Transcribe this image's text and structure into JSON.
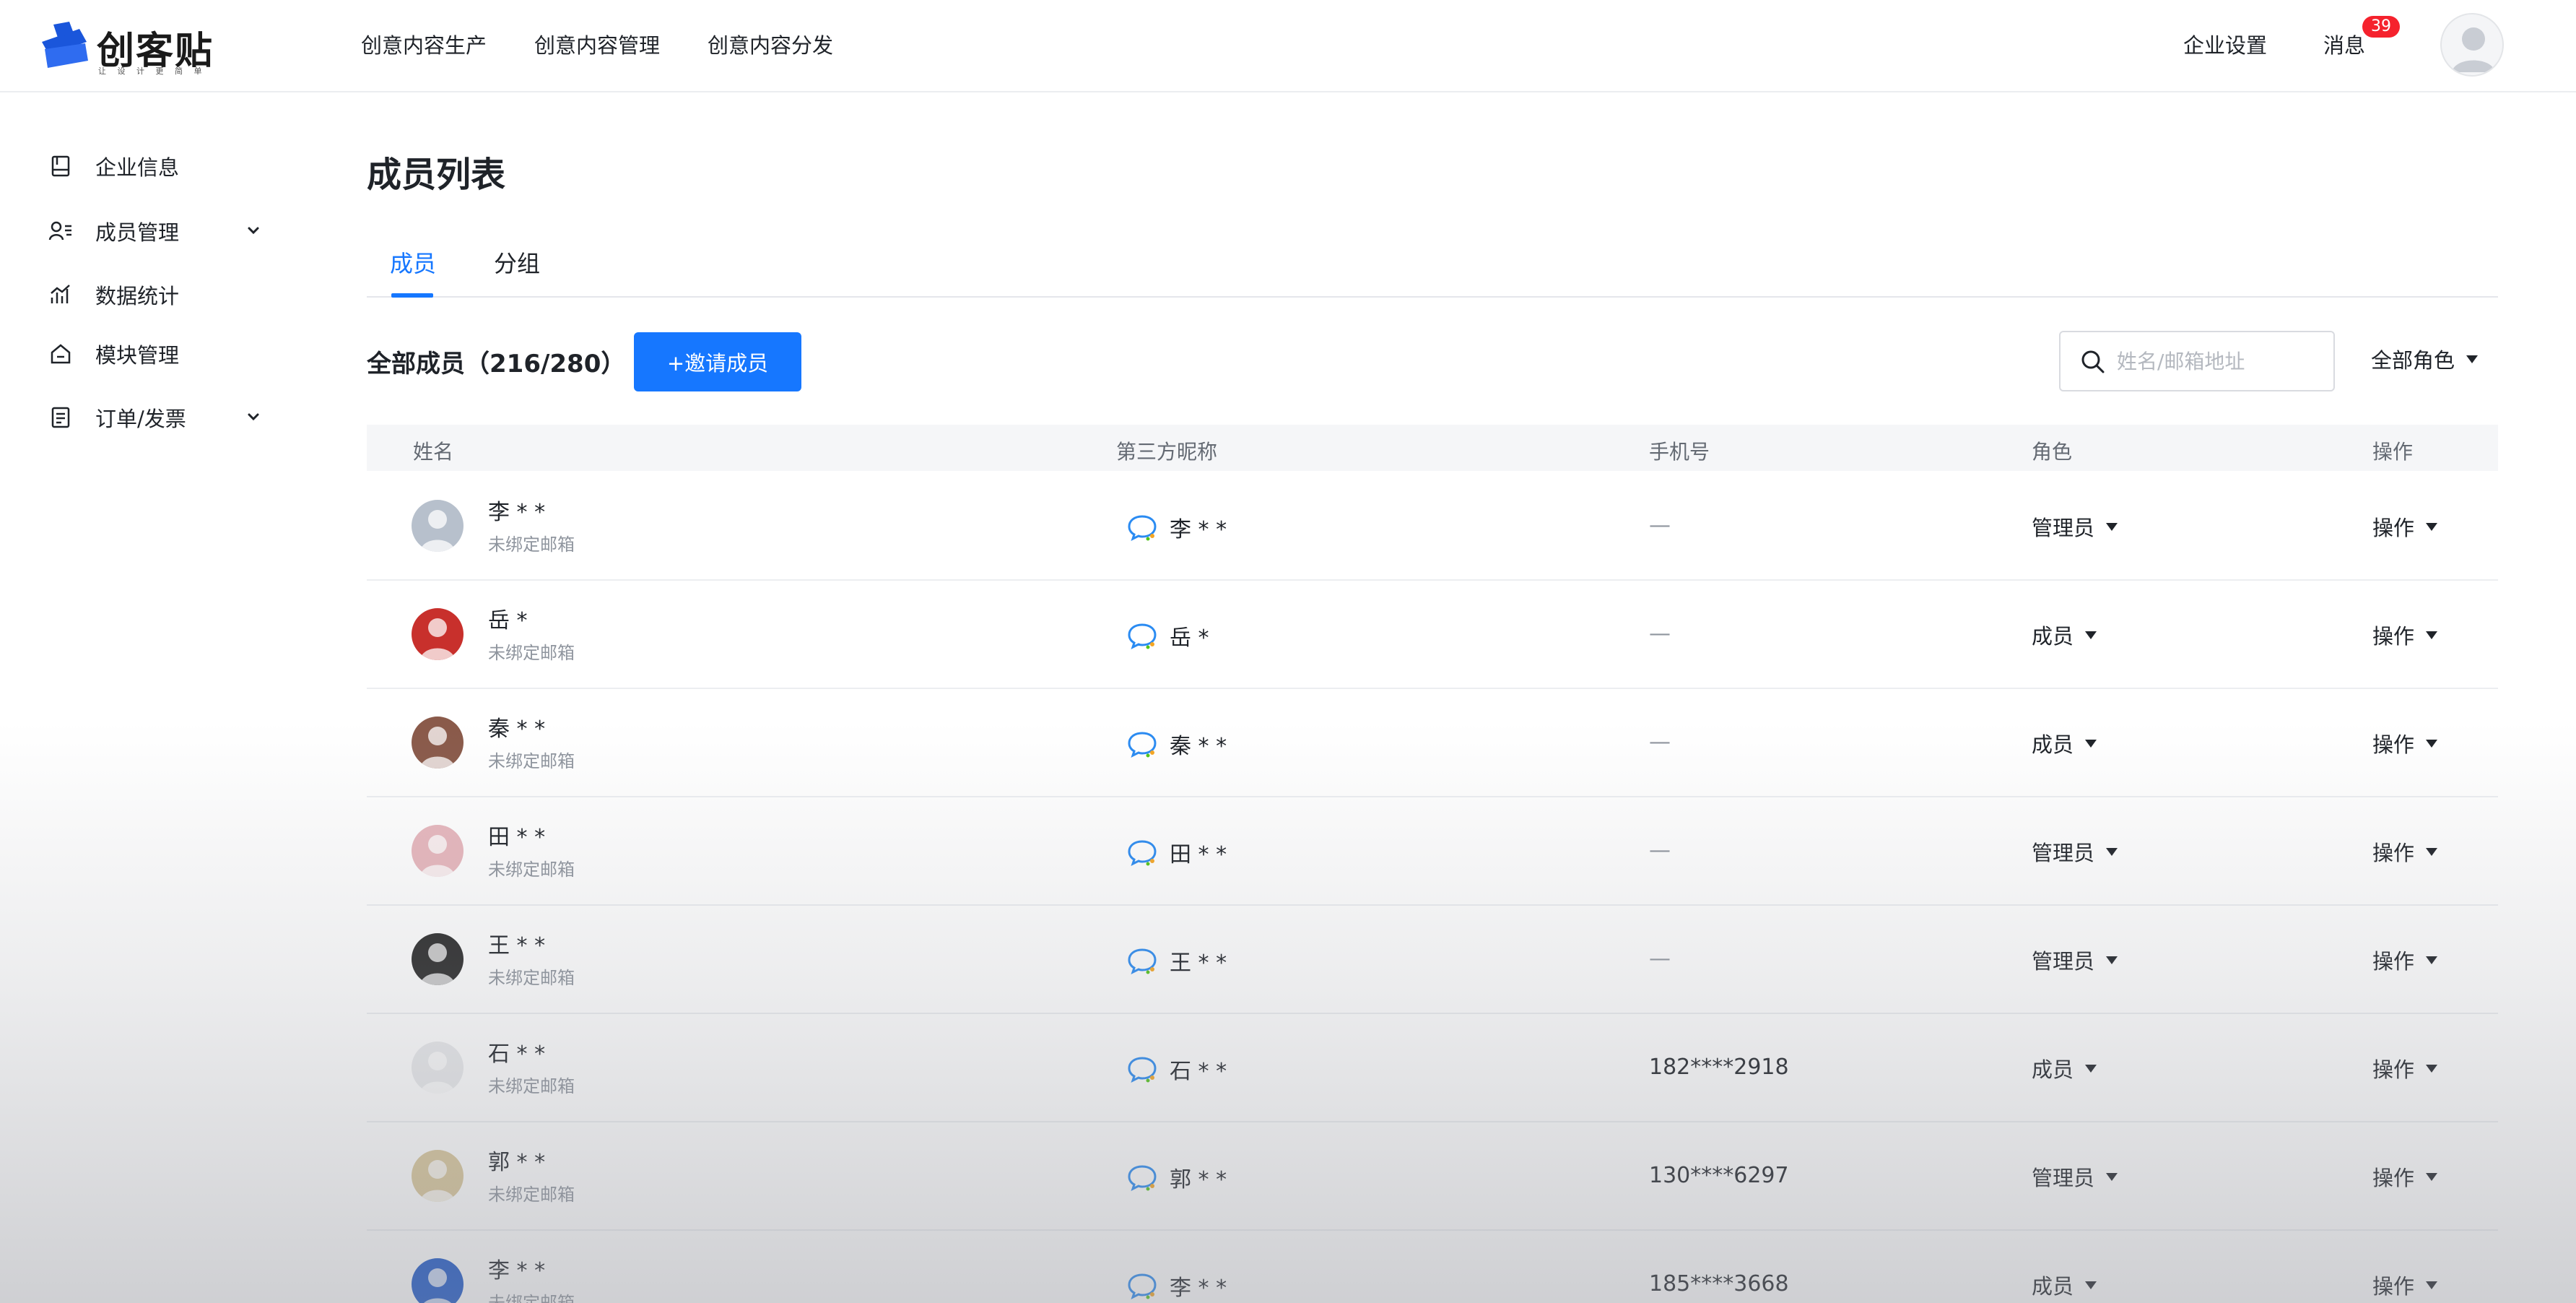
{
  "brand": {
    "name": "创客贴",
    "tagline": "让 设 计 更 简 单",
    "accent_color": "#1677ff"
  },
  "nav": {
    "items": [
      "创意内容生产",
      "创意内容管理",
      "创意内容分发"
    ]
  },
  "top_right": {
    "settings_label": "企业设置",
    "messages_label": "消息",
    "messages_badge": "39"
  },
  "sidebar": {
    "items": [
      {
        "label": "企业信息",
        "icon": "book-icon"
      },
      {
        "label": "成员管理",
        "icon": "user-list-icon"
      },
      {
        "label": "数据统计",
        "icon": "chart-icon"
      },
      {
        "label": "模块管理",
        "icon": "module-icon"
      },
      {
        "label": "订单/发票",
        "icon": "receipt-icon"
      }
    ]
  },
  "main": {
    "title": "成员列表",
    "tabs": [
      {
        "label": "成员",
        "active": true
      },
      {
        "label": "分组",
        "active": false
      }
    ],
    "member_count_label": "全部成员（216/280）",
    "invite_label": "+邀请成员",
    "search_placeholder": "姓名/邮箱地址",
    "search_value": "",
    "role_filter_label": "全部角色"
  },
  "table": {
    "headers": {
      "name": "姓名",
      "third_party": "第三方昵称",
      "phone": "手机号",
      "role": "角色",
      "action": "操作"
    },
    "rows": [
      {
        "name": "李 * *",
        "email": "未绑定邮箱",
        "third": "李 * *",
        "phone": "—",
        "role": "管理员",
        "action": "操作",
        "avatar_color": "#b7c0cc"
      },
      {
        "name": "岳 *",
        "email": "未绑定邮箱",
        "third": "岳 *",
        "phone": "—",
        "role": "成员",
        "action": "操作",
        "avatar_color": "#c8302c"
      },
      {
        "name": "秦 * *",
        "email": "未绑定邮箱",
        "third": "秦 * *",
        "phone": "—",
        "role": "成员",
        "action": "操作",
        "avatar_color": "#8a5a4a"
      },
      {
        "name": "田 * *",
        "email": "未绑定邮箱",
        "third": "田 * *",
        "phone": "—",
        "role": "管理员",
        "action": "操作",
        "avatar_color": "#e7b7bd"
      },
      {
        "name": "王 * *",
        "email": "未绑定邮箱",
        "third": "王 * *",
        "phone": "—",
        "role": "管理员",
        "action": "操作",
        "avatar_color": "#2b2b2b"
      },
      {
        "name": "石 * *",
        "email": "未绑定邮箱",
        "third": "石 * *",
        "phone": "182****2918",
        "role": "成员",
        "action": "操作",
        "avatar_color": "#e9eaec"
      },
      {
        "name": "郭 * *",
        "email": "未绑定邮箱",
        "third": "郭 * *",
        "phone": "130****6297",
        "role": "管理员",
        "action": "操作",
        "avatar_color": "#d9c79a"
      },
      {
        "name": "李 * *",
        "email": "未绑定邮箱",
        "third": "李 * *",
        "phone": "185****3668",
        "role": "成员",
        "action": "操作",
        "avatar_color": "#1a56c8"
      }
    ]
  }
}
